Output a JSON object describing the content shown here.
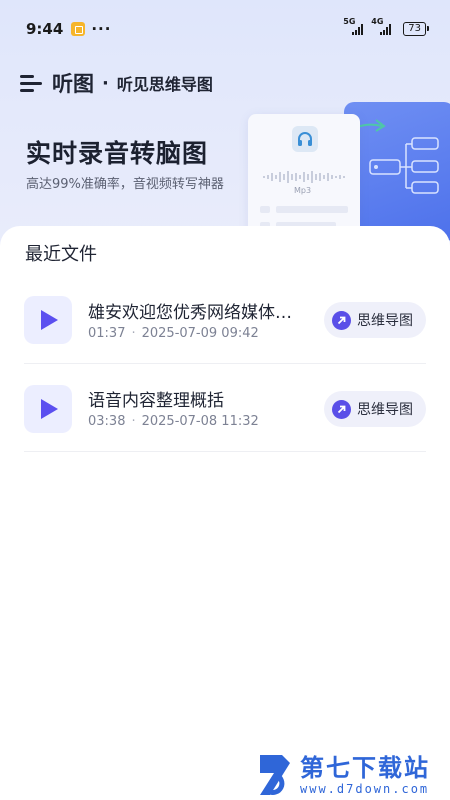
{
  "status_bar": {
    "time": "9:44",
    "more": "···",
    "net1": "5G",
    "net2": "4G",
    "battery": "73"
  },
  "header": {
    "brand": "听图",
    "dot": "·",
    "slogan": "听见思维导图"
  },
  "hero": {
    "title": "实时录音转脑图",
    "subtitle": "高达99%准确率，音视频转写神器",
    "illustration_label": "Mp3"
  },
  "recent": {
    "title": "最近文件",
    "files": [
      {
        "name": "雄安欢迎您优秀网络媒体…",
        "duration": "01:37",
        "sep": "·",
        "datetime": "2025-07-09 09:42",
        "action": "思维导图"
      },
      {
        "name": "语音内容整理概括",
        "duration": "03:38",
        "sep": "·",
        "datetime": "2025-07-08 11:32",
        "action": "思维导图"
      }
    ]
  },
  "watermark": {
    "title": "第七下载站",
    "url": "www.d7down.com"
  },
  "colors": {
    "accent": "#5b4ff0",
    "hero_bg": "#e2e8fb",
    "illustration_blue": "#4d71eb",
    "watermark": "#2f66d8"
  }
}
